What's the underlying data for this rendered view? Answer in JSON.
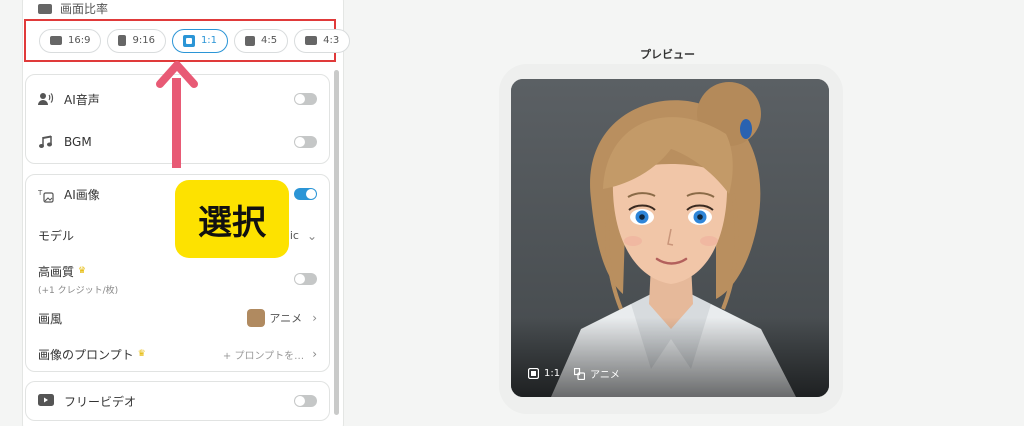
{
  "aspect": {
    "title": "画面比率",
    "options": [
      {
        "label": "16:9",
        "icon": "landscape-icon",
        "selected": false
      },
      {
        "label": "9:16",
        "icon": "portrait-icon",
        "selected": false
      },
      {
        "label": "1:1",
        "icon": "square-icon",
        "selected": true
      },
      {
        "label": "4:5",
        "icon": "portrait-icon",
        "selected": false
      },
      {
        "label": "4:3",
        "icon": "landscape-icon",
        "selected": false
      }
    ]
  },
  "audio": {
    "ai_voice": {
      "label": "AI音声",
      "on": false
    },
    "bgm": {
      "label": "BGM",
      "on": false
    }
  },
  "ai_image": {
    "label": "AI画像",
    "on": true,
    "model": {
      "label": "モデル",
      "value": "ic"
    },
    "hq": {
      "label": "高画質",
      "sub": "(+1 クレジット/枚)",
      "on": false
    },
    "style": {
      "label": "画風",
      "value": "アニメ"
    },
    "prompt": {
      "label": "画像のプロンプト",
      "value": "+ プロンプトを…"
    }
  },
  "free_video": {
    "label": "フリービデオ",
    "on": false
  },
  "callout": {
    "text": "選択"
  },
  "preview": {
    "title": "プレビュー",
    "ratio": "1:1",
    "style": "アニメ"
  },
  "colors": {
    "accent": "#2b95d6",
    "highlight_border": "#e03a3a",
    "arrow": "#e85a75",
    "callout_bg": "#fde200"
  }
}
